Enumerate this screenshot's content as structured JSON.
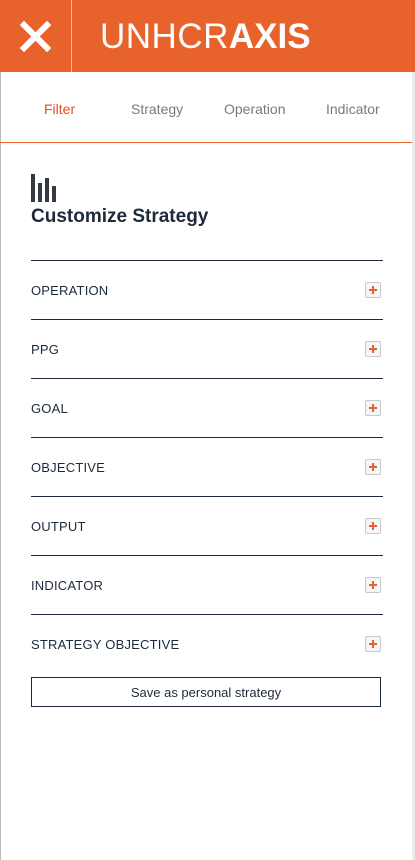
{
  "header": {
    "brand_light": "UNHCR",
    "brand_bold": "AXIS",
    "accent_color": "#e8622c",
    "close_icon": "close-icon"
  },
  "tabs": [
    {
      "label": "Filter",
      "active": true
    },
    {
      "label": "Strategy",
      "active": false
    },
    {
      "label": "Operation",
      "active": false
    },
    {
      "label": "Indicator",
      "active": false
    }
  ],
  "panel": {
    "icon": "bar-chart-icon",
    "title": "Customize Strategy",
    "filters": [
      {
        "label": "OPERATION",
        "icon": "plus-icon"
      },
      {
        "label": "PPG",
        "icon": "plus-icon"
      },
      {
        "label": "GOAL",
        "icon": "plus-icon"
      },
      {
        "label": "OBJECTIVE",
        "icon": "plus-icon"
      },
      {
        "label": "OUTPUT",
        "icon": "plus-icon"
      },
      {
        "label": "INDICATOR",
        "icon": "plus-icon"
      },
      {
        "label": "STRATEGY OBJECTIVE",
        "icon": "plus-icon"
      }
    ],
    "save_label": "Save as personal strategy"
  }
}
